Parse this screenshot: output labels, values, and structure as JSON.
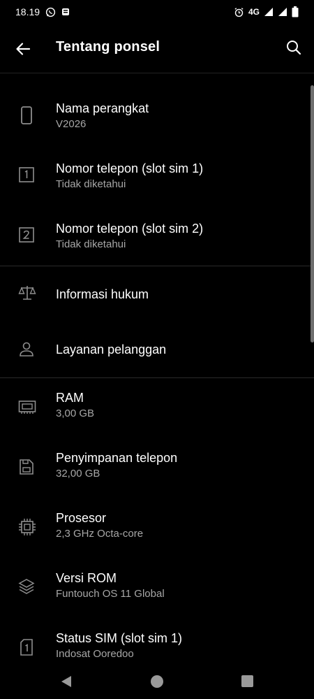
{
  "status_bar": {
    "time": "18.19",
    "network": "4G"
  },
  "header": {
    "title": "Tentang ponsel"
  },
  "items": [
    {
      "label": "Nama perangkat",
      "sub": "V2026",
      "icon": "phone-icon"
    },
    {
      "label": "Nomor telepon (slot sim 1)",
      "sub": "Tidak diketahui",
      "icon": "sim-1-icon"
    },
    {
      "label": "Nomor telepon (slot sim 2)",
      "sub": "Tidak diketahui",
      "icon": "sim-2-icon"
    },
    {
      "label": "Informasi hukum",
      "sub": "",
      "icon": "scale-icon"
    },
    {
      "label": "Layanan pelanggan",
      "sub": "",
      "icon": "person-icon"
    },
    {
      "label": "RAM",
      "sub": "3,00 GB",
      "icon": "ram-icon"
    },
    {
      "label": "Penyimpanan telepon",
      "sub": "32,00 GB",
      "icon": "storage-icon"
    },
    {
      "label": "Prosesor",
      "sub": "2,3 GHz Octa-core",
      "icon": "cpu-icon"
    },
    {
      "label": "Versi ROM",
      "sub": "Funtouch OS 11 Global",
      "icon": "layers-icon"
    },
    {
      "label": "Status SIM (slot sim 1)",
      "sub": "Indosat Ooredoo",
      "icon": "sim-1-icon"
    }
  ]
}
